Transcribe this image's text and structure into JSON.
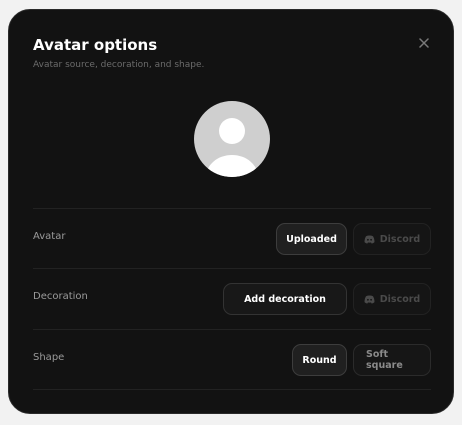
{
  "modal": {
    "title": "Avatar options",
    "subtitle": "Avatar source, decoration, and shape.",
    "close_icon": "close-icon"
  },
  "avatar_preview": {
    "icon": "default-user-avatar-icon"
  },
  "rows": {
    "avatar": {
      "label": "Avatar",
      "uploaded_label": "Uploaded",
      "discord_label": "Discord",
      "selected": "Uploaded"
    },
    "decoration": {
      "label": "Decoration",
      "add_label": "Add decoration",
      "discord_label": "Discord"
    },
    "shape": {
      "label": "Shape",
      "round_label": "Round",
      "soft_square_label": "Soft square",
      "selected": "Round"
    }
  },
  "colors": {
    "background": "#121212",
    "border": "#2a2a2a",
    "avatar_bg": "#cfcfcf"
  }
}
